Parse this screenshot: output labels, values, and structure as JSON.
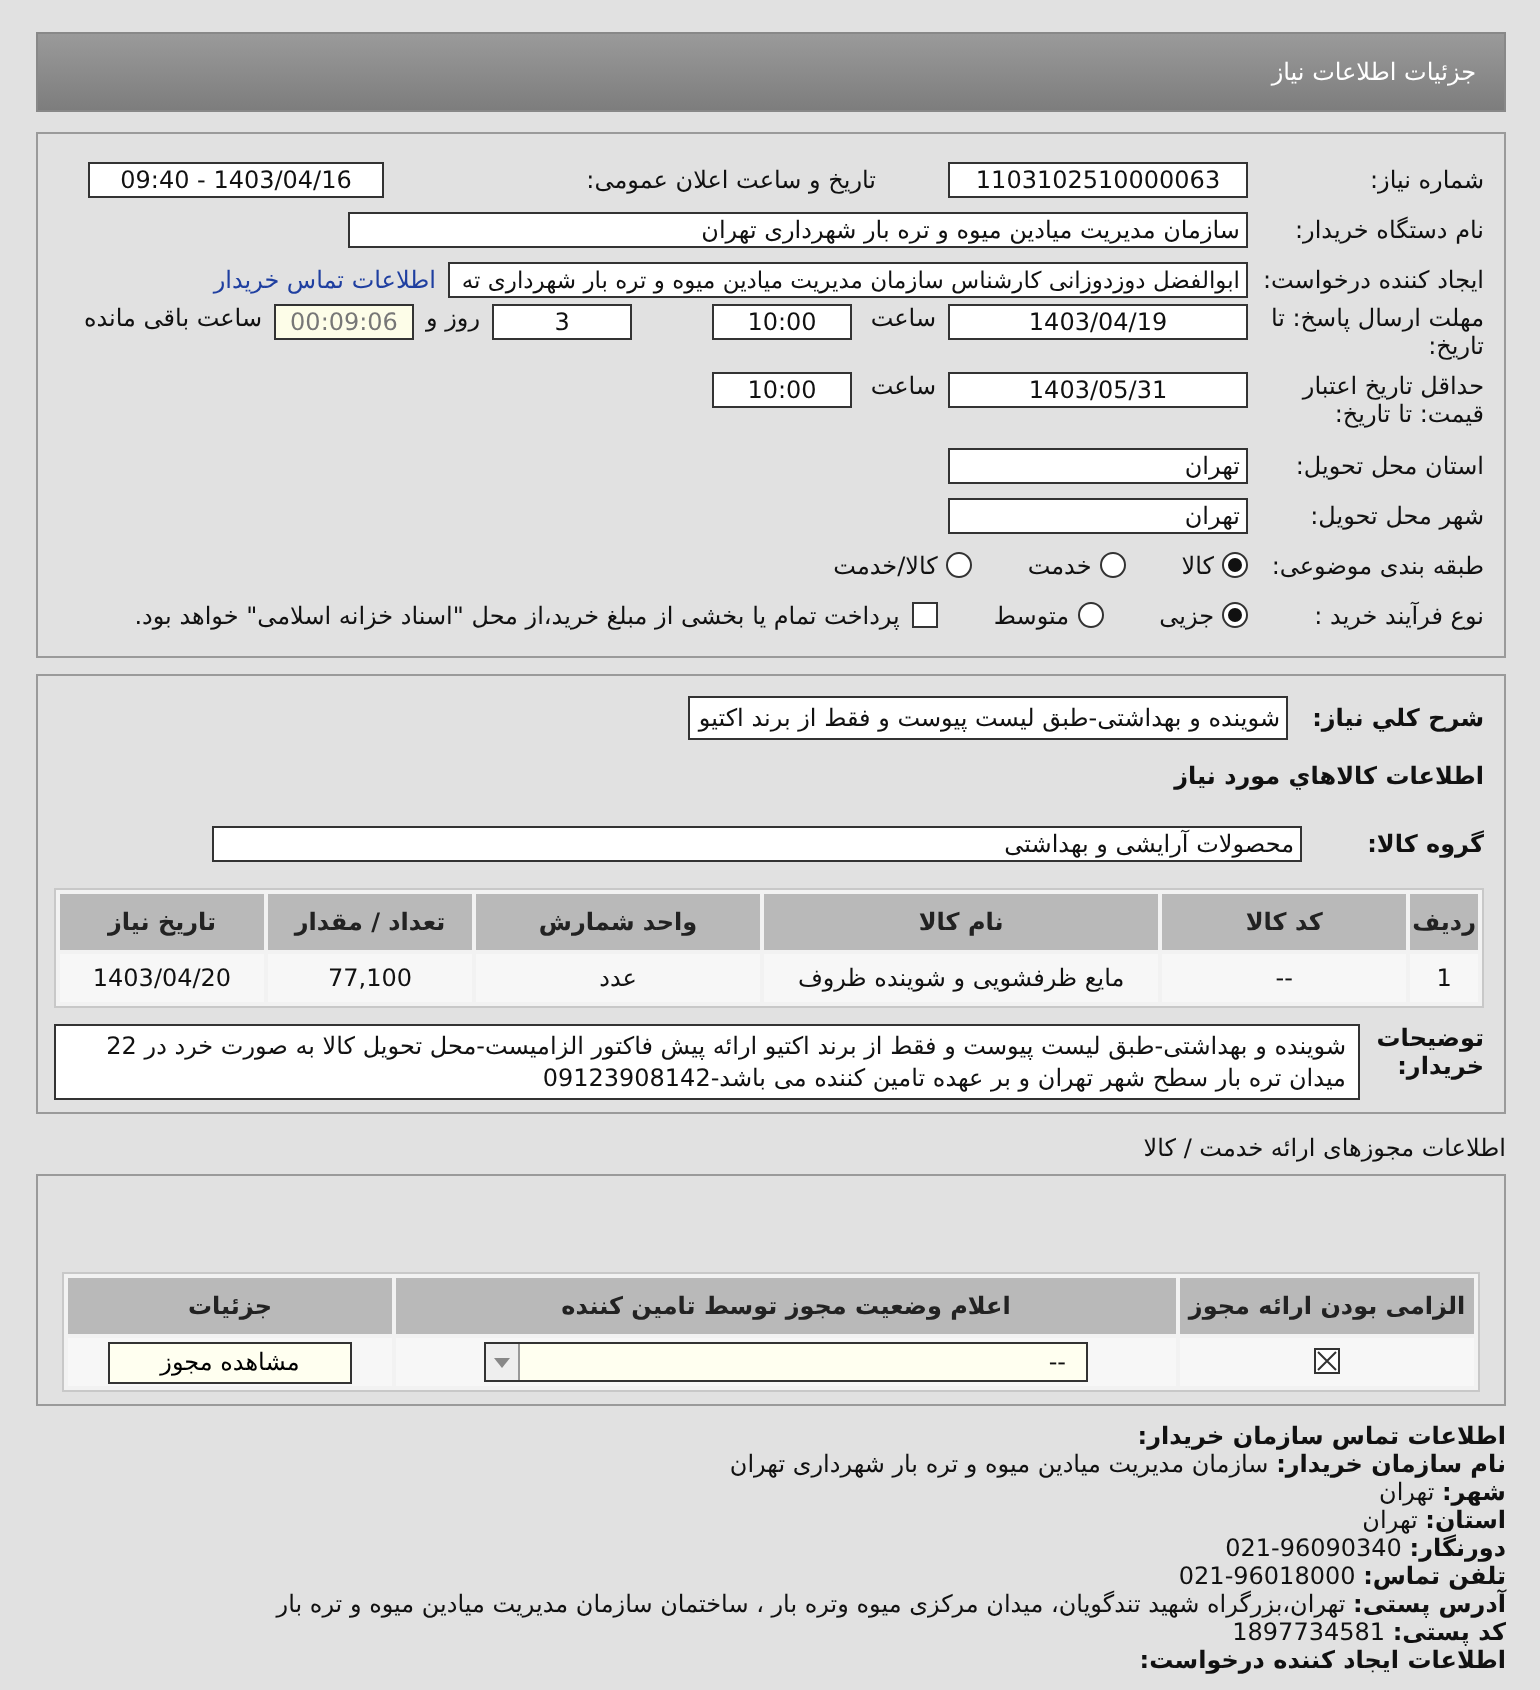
{
  "header": {
    "title": "جزئیات اطلاعات نیاز"
  },
  "need": {
    "need_number": {
      "label": "شماره نیاز:",
      "value": "1103102510000063"
    },
    "announce": {
      "label": "تاریخ و ساعت اعلان عمومی:",
      "value": "1403/04/16 - 09:40"
    },
    "buyer_org": {
      "label": "نام دستگاه خریدار:",
      "value": "سازمان مدیریت میادین میوه و تره بار شهرداری تهران"
    },
    "requester": {
      "label": "ایجاد کننده درخواست:",
      "value": "ابوالفضل دوزدوزانی کارشناس سازمان مدیریت میادین میوه و تره بار شهرداری ته",
      "link": "اطلاعات تماس خریدار"
    },
    "deadline": {
      "label": "مهلت ارسال پاسخ: تا تاریخ:",
      "date": "1403/04/19",
      "time_label": "ساعت",
      "time": "10:00",
      "days": "3",
      "days_label": "روز و",
      "remaining": "00:09:06",
      "remaining_label": "ساعت باقی مانده"
    },
    "validity": {
      "label": "حداقل تاریخ اعتبار قیمت: تا تاریخ:",
      "date": "1403/05/31",
      "time_label": "ساعت",
      "time": "10:00"
    },
    "province": {
      "label": "استان محل تحویل:",
      "value": "تهران"
    },
    "city": {
      "label": "شهر محل تحویل:",
      "value": "تهران"
    },
    "category": {
      "label": "طبقه بندی موضوعی:",
      "options": [
        {
          "label": "کالا",
          "selected": true
        },
        {
          "label": "خدمت",
          "selected": false
        },
        {
          "label": "کالا/خدمت",
          "selected": false
        }
      ]
    },
    "purchase_type": {
      "label": "نوع فرآیند خرید :",
      "options": [
        {
          "label": "جزیی",
          "selected": true
        },
        {
          "label": "متوسط",
          "selected": false
        }
      ],
      "payment": {
        "label": "پرداخت تمام یا بخشی از مبلغ خرید،از محل \"اسناد خزانه اسلامی\" خواهد بود.",
        "checked": false
      }
    }
  },
  "goods": {
    "summary": {
      "label": "شرح کلي نیاز:",
      "value": "شوینده و بهداشتی-طبق لیست پیوست و فقط از برند اکتیو"
    },
    "heading": "اطلاعات کالاهاي مورد نیاز",
    "group": {
      "label": "گروه کالا:",
      "value": "محصولات آرایشی و بهداشتی"
    },
    "table": {
      "columns": [
        "ردیف",
        "کد کالا",
        "نام کالا",
        "واحد شمارش",
        "تعداد / مقدار",
        "تاریخ نیاز"
      ],
      "rows": [
        [
          "1",
          "--",
          "مایع ظرفشویی و شوینده ظروف",
          "عدد",
          "77,100",
          "1403/04/20"
        ]
      ]
    },
    "notes": {
      "label": "توضیحات خریدار:",
      "value": "شوینده و بهداشتی-طبق لیست پیوست و فقط از برند اکتیو ارائه پیش فاکتور الزامیست-محل تحویل کالا به صورت خرد در 22 میدان تره بار سطح شهر تهران و بر عهده تامین کننده می باشد-09123908142"
    }
  },
  "licenses": {
    "title": "اطلاعات مجوزهای ارائه خدمت / کالا",
    "columns": [
      "الزامی بودن ارائه مجوز",
      "اعلام وضعیت مجوز توسط تامین کننده",
      "جزئیات"
    ],
    "rows": [
      {
        "required": true,
        "status": "--",
        "button": "مشاهده مجوز"
      }
    ]
  },
  "contact": {
    "title": "اطلاعات تماس سازمان خریدار:",
    "lines": [
      {
        "label": "نام سازمان خریدار:",
        "value": "سازمان مدیریت میادین میوه و تره بار شهرداری تهران"
      },
      {
        "label": "شهر:",
        "value": "تهران"
      },
      {
        "label": "استان:",
        "value": "تهران"
      },
      {
        "label": "دورنگار:",
        "value": "96090340-021"
      },
      {
        "label": "تلفن تماس:",
        "value": "96018000-021"
      },
      {
        "label": "آدرس پستی:",
        "value": "تهران،بزرگراه شهید تندگویان، میدان مرکزی میوه وتره بار ، ساختمان سازمان مدیریت میادین میوه و تره بار"
      },
      {
        "label": "کد پستی:",
        "value": "1897734581"
      }
    ],
    "next_title": "اطلاعات ایجاد کننده درخواست:"
  }
}
